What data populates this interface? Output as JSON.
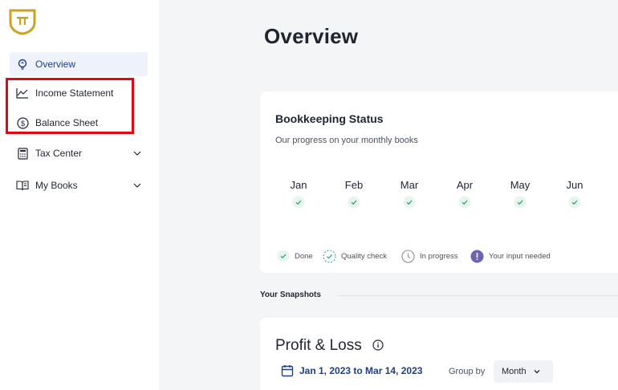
{
  "sidebar": {
    "logo_icon": "pillar-shield-logo",
    "items": [
      {
        "label": "Overview",
        "icon": "lightbulb-icon",
        "active": true
      },
      {
        "label": "Income Statement",
        "icon": "line-chart-icon"
      },
      {
        "label": "Balance Sheet",
        "icon": "dollar-circle-icon"
      },
      {
        "label": "Tax Center",
        "icon": "calculator-icon",
        "expandable": true
      },
      {
        "label": "My Books",
        "icon": "book-icon",
        "expandable": true
      }
    ]
  },
  "page": {
    "title": "Overview"
  },
  "bookkeeping": {
    "title": "Bookkeeping Status",
    "subtitle": "Our progress on your monthly books",
    "months": [
      {
        "label": "Jan",
        "status": "done"
      },
      {
        "label": "Feb",
        "status": "done"
      },
      {
        "label": "Mar",
        "status": "done"
      },
      {
        "label": "Apr",
        "status": "done"
      },
      {
        "label": "May",
        "status": "done"
      },
      {
        "label": "Jun",
        "status": "done"
      }
    ],
    "legend": {
      "done": "Done",
      "quality": "Quality check",
      "progress": "In progress",
      "input": "Your input needed"
    }
  },
  "snapshots": {
    "label": "Your Snapshots"
  },
  "profit_loss": {
    "title": "Profit & Loss",
    "date_range": "Jan 1, 2023 to Mar 14, 2023",
    "group_by_label": "Group by",
    "group_by_value": "Month"
  },
  "colors": {
    "accent": "#1d3e86",
    "logo_gold": "#c9a227",
    "done_green": "#2ea36b",
    "input_purple": "#6b63b5",
    "highlight_red": "#e30613"
  }
}
